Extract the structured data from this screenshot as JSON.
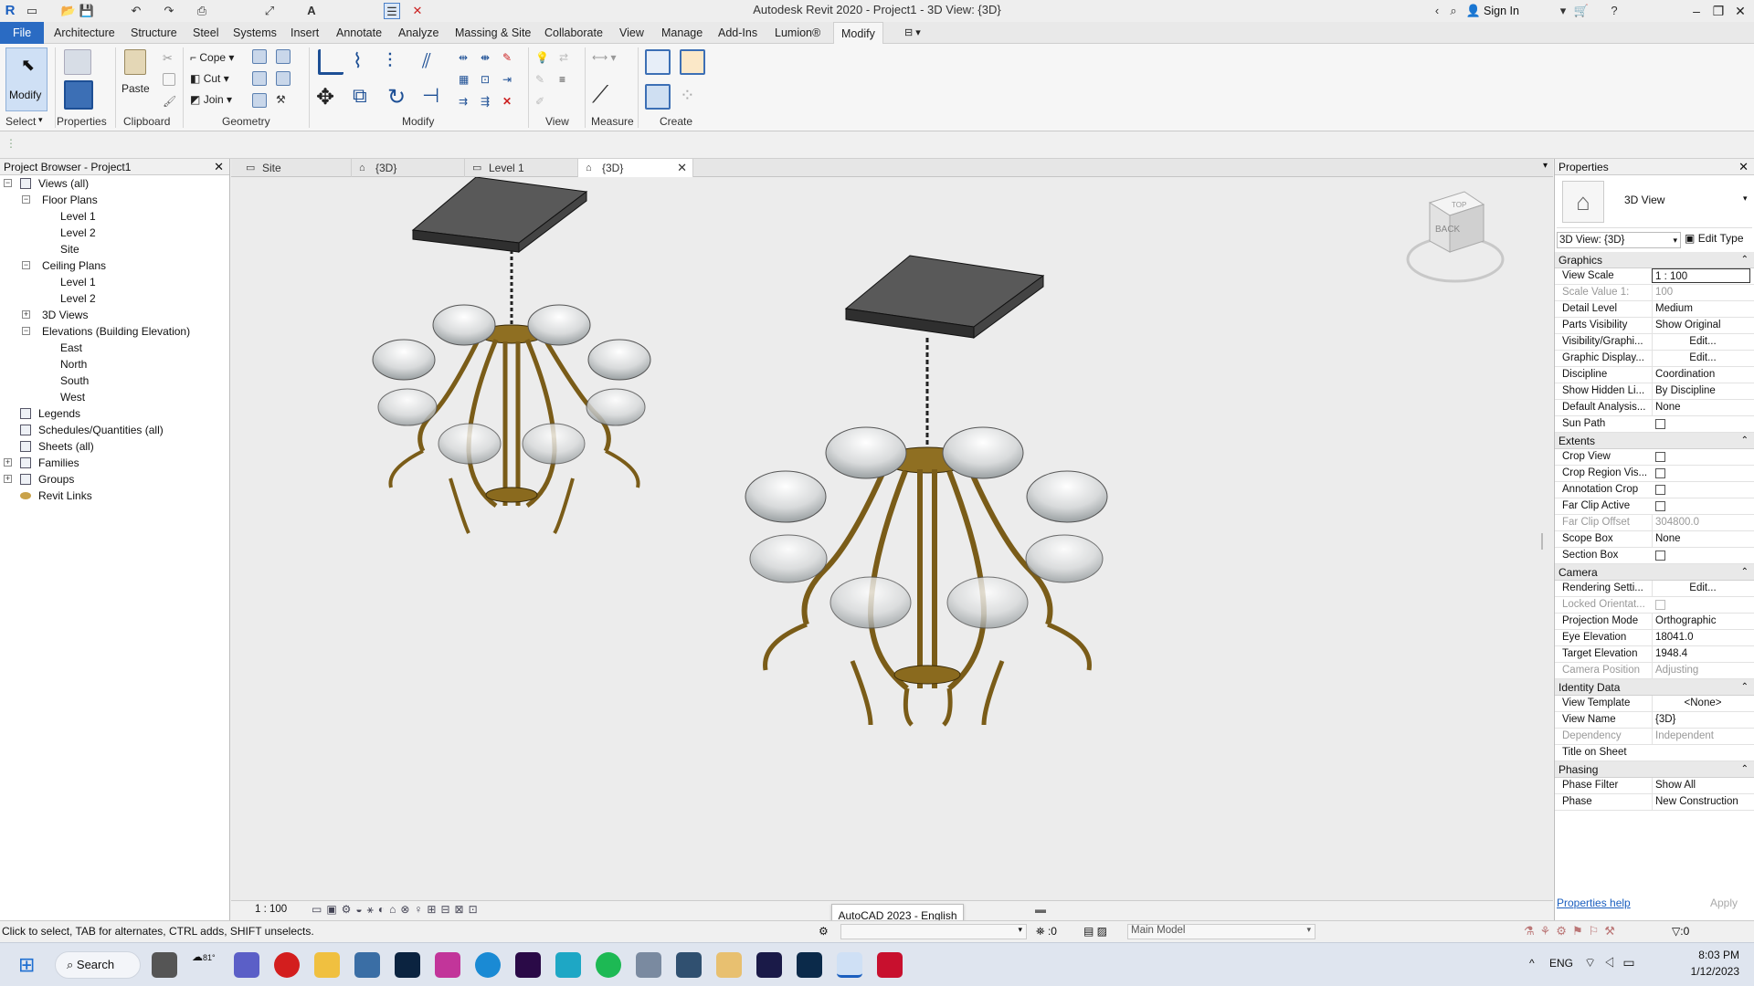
{
  "app": {
    "title": "Autodesk Revit 2020 - Project1 - 3D View: {3D}",
    "sign_in": "Sign In"
  },
  "ribbon": {
    "tabs": [
      "File",
      "Architecture",
      "Structure",
      "Steel",
      "Systems",
      "Insert",
      "Annotate",
      "Analyze",
      "Massing & Site",
      "Collaborate",
      "View",
      "Manage",
      "Add-Ins",
      "Lumion®",
      "Modify"
    ],
    "active_tab": "Modify",
    "modify_label": "Modify",
    "properties_label": "Properties",
    "paste_label": "Paste",
    "cope_label": "Cope",
    "cut_label": "Cut",
    "join_label": "Join",
    "panels": {
      "select": "Select",
      "properties": "Properties",
      "clipboard": "Clipboard",
      "geometry": "Geometry",
      "modify": "Modify",
      "view": "View",
      "measure": "Measure",
      "create": "Create"
    }
  },
  "project_browser": {
    "title": "Project Browser - Project1",
    "tree": [
      {
        "label": "Views (all)",
        "level": 0,
        "toggle": "-",
        "icon": "views-icon"
      },
      {
        "label": "Floor Plans",
        "level": 1,
        "toggle": "-"
      },
      {
        "label": "Level 1",
        "level": 2
      },
      {
        "label": "Level 2",
        "level": 2
      },
      {
        "label": "Site",
        "level": 2
      },
      {
        "label": "Ceiling Plans",
        "level": 1,
        "toggle": "-"
      },
      {
        "label": "Level 1",
        "level": 2
      },
      {
        "label": "Level 2",
        "level": 2
      },
      {
        "label": "3D Views",
        "level": 1,
        "toggle": "+"
      },
      {
        "label": "Elevations (Building Elevation)",
        "level": 1,
        "toggle": "-"
      },
      {
        "label": "East",
        "level": 2
      },
      {
        "label": "North",
        "level": 2
      },
      {
        "label": "South",
        "level": 2
      },
      {
        "label": "West",
        "level": 2
      },
      {
        "label": "Legends",
        "level": 0,
        "icon": "legend-icon"
      },
      {
        "label": "Schedules/Quantities (all)",
        "level": 0,
        "icon": "schedule-icon"
      },
      {
        "label": "Sheets (all)",
        "level": 0,
        "icon": "sheet-icon"
      },
      {
        "label": "Families",
        "level": 0,
        "toggle": "+",
        "icon": "families-icon"
      },
      {
        "label": "Groups",
        "level": 0,
        "toggle": "+",
        "icon": "groups-icon"
      },
      {
        "label": "Revit Links",
        "level": 0,
        "icon": "links-icon"
      }
    ]
  },
  "view_tabs": [
    {
      "label": "Site",
      "active": false
    },
    {
      "label": "{3D}",
      "active": false
    },
    {
      "label": "Level 1",
      "active": false
    },
    {
      "label": "{3D}",
      "active": true
    }
  ],
  "viewcube": {
    "face": "BACK",
    "top": "TOP"
  },
  "view_control_bar": {
    "scale": "1 : 100"
  },
  "properties": {
    "title": "Properties",
    "type_name": "3D View",
    "selector": "3D View: {3D}",
    "edit_type": "Edit Type",
    "sections": [
      {
        "name": "Graphics",
        "rows": [
          {
            "k": "View Scale",
            "v": "1 : 100",
            "boxed": true
          },
          {
            "k": "Scale Value    1:",
            "v": "100",
            "dim": true
          },
          {
            "k": "Detail Level",
            "v": "Medium"
          },
          {
            "k": "Parts Visibility",
            "v": "Show Original"
          },
          {
            "k": "Visibility/Graphi...",
            "v": "Edit...",
            "center": true
          },
          {
            "k": "Graphic Display...",
            "v": "Edit...",
            "center": true
          },
          {
            "k": "Discipline",
            "v": "Coordination"
          },
          {
            "k": "Show Hidden Li...",
            "v": "By Discipline"
          },
          {
            "k": "Default Analysis...",
            "v": "None"
          },
          {
            "k": "Sun Path",
            "checkbox": true
          }
        ]
      },
      {
        "name": "Extents",
        "rows": [
          {
            "k": "Crop View",
            "checkbox": true
          },
          {
            "k": "Crop Region Vis...",
            "checkbox": true
          },
          {
            "k": "Annotation Crop",
            "checkbox": true
          },
          {
            "k": "Far Clip Active",
            "checkbox": true
          },
          {
            "k": "Far Clip Offset",
            "v": "304800.0",
            "dim": true
          },
          {
            "k": "Scope Box",
            "v": "None"
          },
          {
            "k": "Section Box",
            "checkbox": true
          }
        ]
      },
      {
        "name": "Camera",
        "rows": [
          {
            "k": "Rendering Setti...",
            "v": "Edit...",
            "center": true
          },
          {
            "k": "Locked Orientat...",
            "checkbox": true,
            "dim": true
          },
          {
            "k": "Projection Mode",
            "v": "Orthographic"
          },
          {
            "k": "Eye Elevation",
            "v": "18041.0"
          },
          {
            "k": "Target Elevation",
            "v": "1948.4"
          },
          {
            "k": "Camera Position",
            "v": "Adjusting",
            "dim": true
          }
        ]
      },
      {
        "name": "Identity Data",
        "rows": [
          {
            "k": "View Template",
            "v": "<None>",
            "center": true
          },
          {
            "k": "View Name",
            "v": "{3D}"
          },
          {
            "k": "Dependency",
            "v": "Independent",
            "dim": true
          },
          {
            "k": "Title on Sheet",
            "v": ""
          }
        ]
      },
      {
        "name": "Phasing",
        "rows": [
          {
            "k": "Phase Filter",
            "v": "Show All"
          },
          {
            "k": "Phase",
            "v": "New Construction"
          }
        ]
      }
    ],
    "help_link": "Properties help",
    "apply": "Apply"
  },
  "status_bar": {
    "message": "Click to select, TAB for alternates, CTRL adds, SHIFT unselects.",
    "zero": ":0",
    "model": "Main Model",
    "filter": ":0"
  },
  "tooltip": "AutoCAD 2023 - English",
  "taskbar": {
    "search": "Search",
    "weather": "81°",
    "lang": "ENG",
    "time": "8:03 PM",
    "date": "1/12/2023"
  },
  "colors": {
    "file_tab": "#2a6bc3",
    "brass": "#8a6a1e",
    "ceiling_plate": "#4a4a4a"
  }
}
